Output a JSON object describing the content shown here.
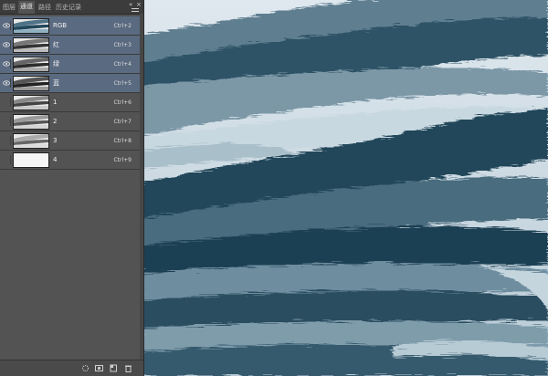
{
  "panel": {
    "tabs": [
      {
        "label": "图层",
        "active": false
      },
      {
        "label": "通道",
        "active": true
      },
      {
        "label": "路径",
        "active": false
      },
      {
        "label": "历史记录",
        "active": false
      }
    ],
    "channels": [
      {
        "name": "RGB",
        "shortcut": "Ctrl+2",
        "selected": true,
        "visible": true
      },
      {
        "name": "红",
        "shortcut": "Ctrl+3",
        "selected": true,
        "visible": true
      },
      {
        "name": "绿",
        "shortcut": "Ctrl+4",
        "selected": true,
        "visible": true
      },
      {
        "name": "蓝",
        "shortcut": "Ctrl+5",
        "selected": true,
        "visible": true
      },
      {
        "name": "1",
        "shortcut": "Ctrl+6",
        "selected": false,
        "visible": false
      },
      {
        "name": "2",
        "shortcut": "Ctrl+7",
        "selected": false,
        "visible": false
      },
      {
        "name": "3",
        "shortcut": "Ctrl+8",
        "selected": false,
        "visible": false
      },
      {
        "name": "4",
        "shortcut": "Ctrl+9",
        "selected": false,
        "visible": false
      }
    ],
    "bottom_icons": [
      "load-selection-icon",
      "save-selection-icon",
      "new-channel-icon",
      "delete-channel-icon"
    ]
  },
  "colors": {
    "panel_bg": "#535353",
    "selected_row": "#5a6a80",
    "ink_dark": "#1e3a4c",
    "ink_mid": "#4f6f80",
    "ink_light": "#c3d3dc"
  }
}
